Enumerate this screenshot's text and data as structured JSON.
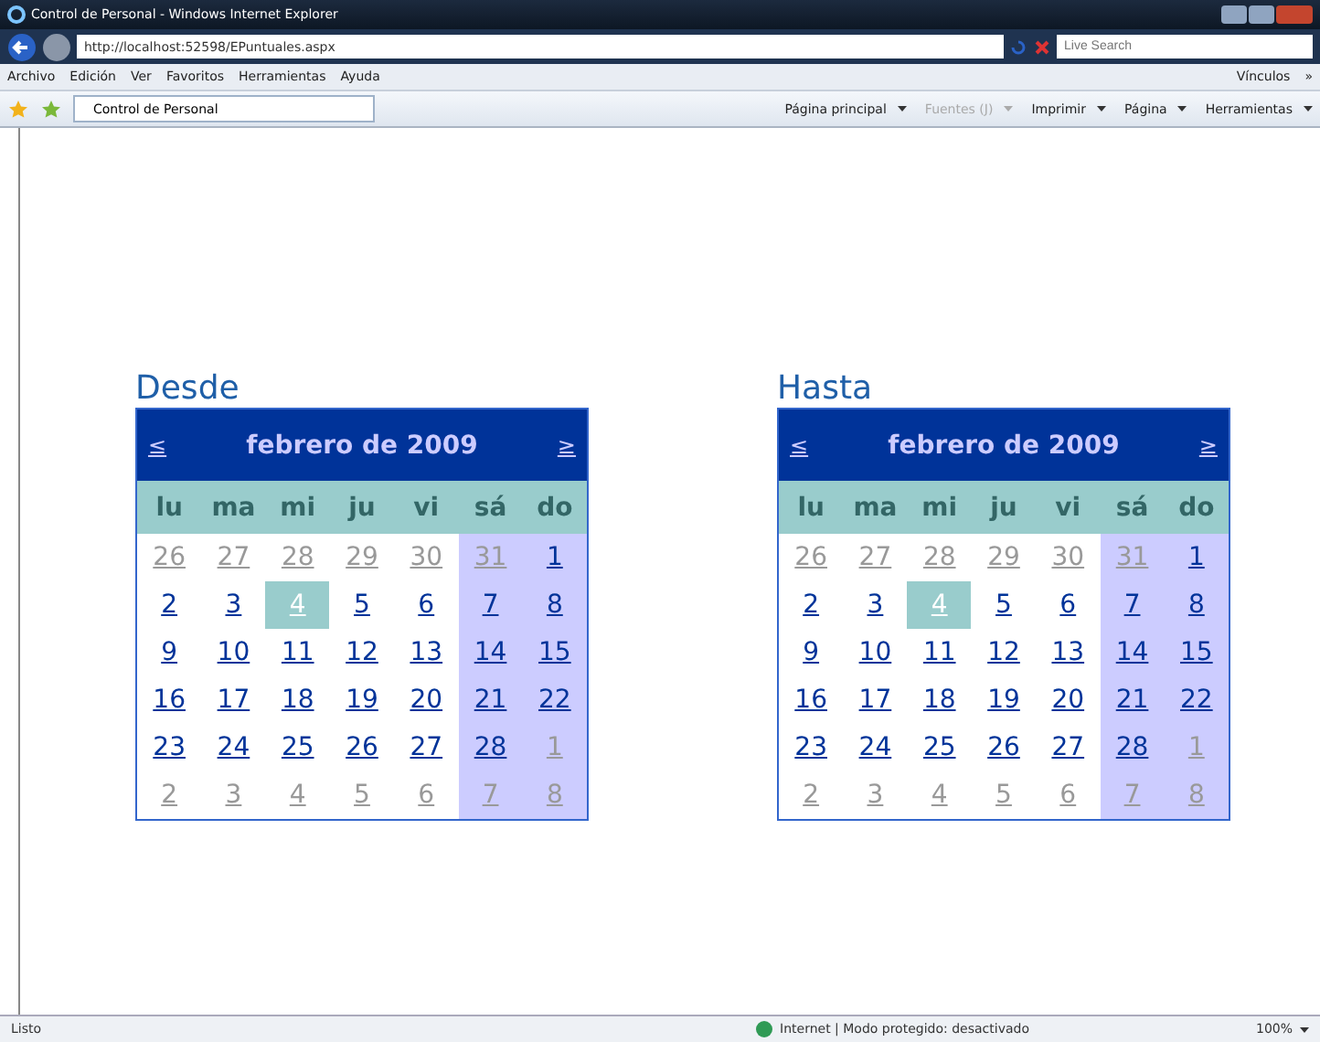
{
  "window": {
    "title": "Control de Personal - Windows Internet Explorer"
  },
  "address_bar": {
    "url": "http://localhost:52598/EPuntuales.aspx",
    "search_placeholder": "Live Search"
  },
  "menu": [
    "Archivo",
    "Edición",
    "Ver",
    "Favoritos",
    "Herramientas",
    "Ayuda"
  ],
  "links": {
    "label": "Vínculos",
    "chevron": "»"
  },
  "tab": {
    "label": "Control de Personal"
  },
  "command_bar": [
    {
      "label": "Página principal",
      "disabled": false
    },
    {
      "label": "Fuentes (J)",
      "disabled": true
    },
    {
      "label": "Imprimir",
      "disabled": false
    },
    {
      "label": "Página",
      "disabled": false
    },
    {
      "label": "Herramientas",
      "disabled": false
    }
  ],
  "calendars": [
    {
      "title": "Desde",
      "prev": "≤",
      "month": "febrero de 2009",
      "next": "≥",
      "weekdays": [
        "lu",
        "ma",
        "mi",
        "ju",
        "vi",
        "sá",
        "do"
      ],
      "weeks": [
        [
          {
            "day": "26",
            "other_month": true,
            "selected": false
          },
          {
            "day": "27",
            "other_month": true,
            "selected": false
          },
          {
            "day": "28",
            "other_month": true,
            "selected": false
          },
          {
            "day": "29",
            "other_month": true,
            "selected": false
          },
          {
            "day": "30",
            "other_month": true,
            "selected": false
          },
          {
            "day": "31",
            "other_month": true,
            "selected": false
          },
          {
            "day": "1",
            "other_month": false,
            "selected": false
          }
        ],
        [
          {
            "day": "2",
            "other_month": false,
            "selected": false
          },
          {
            "day": "3",
            "other_month": false,
            "selected": false
          },
          {
            "day": "4",
            "other_month": false,
            "selected": true
          },
          {
            "day": "5",
            "other_month": false,
            "selected": false
          },
          {
            "day": "6",
            "other_month": false,
            "selected": false
          },
          {
            "day": "7",
            "other_month": false,
            "selected": false
          },
          {
            "day": "8",
            "other_month": false,
            "selected": false
          }
        ],
        [
          {
            "day": "9",
            "other_month": false,
            "selected": false
          },
          {
            "day": "10",
            "other_month": false,
            "selected": false
          },
          {
            "day": "11",
            "other_month": false,
            "selected": false
          },
          {
            "day": "12",
            "other_month": false,
            "selected": false
          },
          {
            "day": "13",
            "other_month": false,
            "selected": false
          },
          {
            "day": "14",
            "other_month": false,
            "selected": false
          },
          {
            "day": "15",
            "other_month": false,
            "selected": false
          }
        ],
        [
          {
            "day": "16",
            "other_month": false,
            "selected": false
          },
          {
            "day": "17",
            "other_month": false,
            "selected": false
          },
          {
            "day": "18",
            "other_month": false,
            "selected": false
          },
          {
            "day": "19",
            "other_month": false,
            "selected": false
          },
          {
            "day": "20",
            "other_month": false,
            "selected": false
          },
          {
            "day": "21",
            "other_month": false,
            "selected": false
          },
          {
            "day": "22",
            "other_month": false,
            "selected": false
          }
        ],
        [
          {
            "day": "23",
            "other_month": false,
            "selected": false
          },
          {
            "day": "24",
            "other_month": false,
            "selected": false
          },
          {
            "day": "25",
            "other_month": false,
            "selected": false
          },
          {
            "day": "26",
            "other_month": false,
            "selected": false
          },
          {
            "day": "27",
            "other_month": false,
            "selected": false
          },
          {
            "day": "28",
            "other_month": false,
            "selected": false
          },
          {
            "day": "1",
            "other_month": true,
            "selected": false
          }
        ],
        [
          {
            "day": "2",
            "other_month": true,
            "selected": false
          },
          {
            "day": "3",
            "other_month": true,
            "selected": false
          },
          {
            "day": "4",
            "other_month": true,
            "selected": false
          },
          {
            "day": "5",
            "other_month": true,
            "selected": false
          },
          {
            "day": "6",
            "other_month": true,
            "selected": false
          },
          {
            "day": "7",
            "other_month": true,
            "selected": false
          },
          {
            "day": "8",
            "other_month": true,
            "selected": false
          }
        ]
      ]
    },
    {
      "title": "Hasta",
      "prev": "≤",
      "month": "febrero de 2009",
      "next": "≥",
      "weekdays": [
        "lu",
        "ma",
        "mi",
        "ju",
        "vi",
        "sá",
        "do"
      ],
      "weeks": [
        [
          {
            "day": "26",
            "other_month": true,
            "selected": false
          },
          {
            "day": "27",
            "other_month": true,
            "selected": false
          },
          {
            "day": "28",
            "other_month": true,
            "selected": false
          },
          {
            "day": "29",
            "other_month": true,
            "selected": false
          },
          {
            "day": "30",
            "other_month": true,
            "selected": false
          },
          {
            "day": "31",
            "other_month": true,
            "selected": false
          },
          {
            "day": "1",
            "other_month": false,
            "selected": false
          }
        ],
        [
          {
            "day": "2",
            "other_month": false,
            "selected": false
          },
          {
            "day": "3",
            "other_month": false,
            "selected": false
          },
          {
            "day": "4",
            "other_month": false,
            "selected": true
          },
          {
            "day": "5",
            "other_month": false,
            "selected": false
          },
          {
            "day": "6",
            "other_month": false,
            "selected": false
          },
          {
            "day": "7",
            "other_month": false,
            "selected": false
          },
          {
            "day": "8",
            "other_month": false,
            "selected": false
          }
        ],
        [
          {
            "day": "9",
            "other_month": false,
            "selected": false
          },
          {
            "day": "10",
            "other_month": false,
            "selected": false
          },
          {
            "day": "11",
            "other_month": false,
            "selected": false
          },
          {
            "day": "12",
            "other_month": false,
            "selected": false
          },
          {
            "day": "13",
            "other_month": false,
            "selected": false
          },
          {
            "day": "14",
            "other_month": false,
            "selected": false
          },
          {
            "day": "15",
            "other_month": false,
            "selected": false
          }
        ],
        [
          {
            "day": "16",
            "other_month": false,
            "selected": false
          },
          {
            "day": "17",
            "other_month": false,
            "selected": false
          },
          {
            "day": "18",
            "other_month": false,
            "selected": false
          },
          {
            "day": "19",
            "other_month": false,
            "selected": false
          },
          {
            "day": "20",
            "other_month": false,
            "selected": false
          },
          {
            "day": "21",
            "other_month": false,
            "selected": false
          },
          {
            "day": "22",
            "other_month": false,
            "selected": false
          }
        ],
        [
          {
            "day": "23",
            "other_month": false,
            "selected": false
          },
          {
            "day": "24",
            "other_month": false,
            "selected": false
          },
          {
            "day": "25",
            "other_month": false,
            "selected": false
          },
          {
            "day": "26",
            "other_month": false,
            "selected": false
          },
          {
            "day": "27",
            "other_month": false,
            "selected": false
          },
          {
            "day": "28",
            "other_month": false,
            "selected": false
          },
          {
            "day": "1",
            "other_month": true,
            "selected": false
          }
        ],
        [
          {
            "day": "2",
            "other_month": true,
            "selected": false
          },
          {
            "day": "3",
            "other_month": true,
            "selected": false
          },
          {
            "day": "4",
            "other_month": true,
            "selected": false
          },
          {
            "day": "5",
            "other_month": true,
            "selected": false
          },
          {
            "day": "6",
            "other_month": true,
            "selected": false
          },
          {
            "day": "7",
            "other_month": true,
            "selected": false
          },
          {
            "day": "8",
            "other_month": true,
            "selected": false
          }
        ]
      ]
    }
  ],
  "status_bar": {
    "status": "Listo",
    "zone": "Internet | Modo protegido: desactivado",
    "zoom": "100%"
  }
}
